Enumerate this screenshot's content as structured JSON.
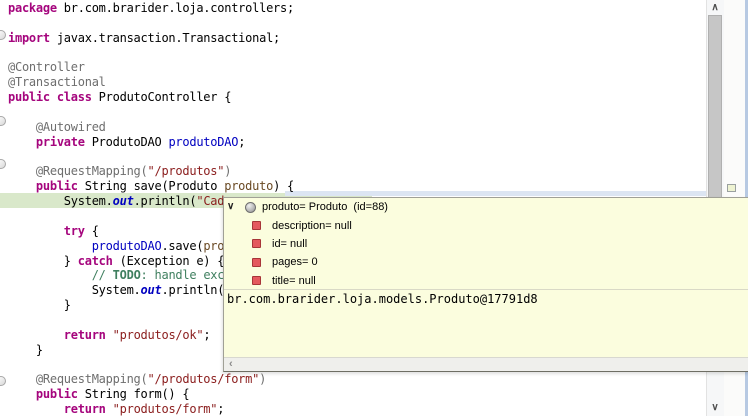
{
  "editor": {
    "lines": [
      {
        "segments": [
          {
            "t": "package",
            "s": "kw"
          },
          {
            "t": " br.com.brarider.loja.controllers;",
            "s": "pl"
          }
        ]
      },
      {
        "segments": []
      },
      {
        "segments": [
          {
            "t": "import",
            "s": "kw"
          },
          {
            "t": " javax.transaction.Transactional;",
            "s": "pl"
          }
        ]
      },
      {
        "segments": []
      },
      {
        "segments": [
          {
            "t": "@Controller",
            "s": "ann"
          }
        ]
      },
      {
        "segments": [
          {
            "t": "@Transactional",
            "s": "ann"
          }
        ]
      },
      {
        "segments": [
          {
            "t": "public class",
            "s": "kw"
          },
          {
            "t": " ProdutoController {",
            "s": "pl"
          }
        ]
      },
      {
        "segments": []
      },
      {
        "segments": [
          {
            "t": "    ",
            "s": "pl"
          },
          {
            "t": "@Autowired",
            "s": "ann"
          }
        ]
      },
      {
        "segments": [
          {
            "t": "    ",
            "s": "pl"
          },
          {
            "t": "private",
            "s": "kw"
          },
          {
            "t": " ProdutoDAO ",
            "s": "pl"
          },
          {
            "t": "produtoDAO",
            "s": "fld"
          },
          {
            "t": ";",
            "s": "pl"
          }
        ]
      },
      {
        "segments": []
      },
      {
        "segments": [
          {
            "t": "    ",
            "s": "pl"
          },
          {
            "t": "@RequestMapping(",
            "s": "ann"
          },
          {
            "t": "\"/produtos\"",
            "s": "str"
          },
          {
            "t": ")",
            "s": "ann"
          }
        ]
      },
      {
        "segments": [
          {
            "t": "    ",
            "s": "pl"
          },
          {
            "t": "public",
            "s": "kw"
          },
          {
            "t": " String save(Produto ",
            "s": "pl"
          },
          {
            "t": "produto",
            "s": "prm"
          },
          {
            "t": ") {",
            "s": "pl"
          }
        ]
      },
      {
        "segments": [
          {
            "t": "        System.",
            "s": "pl"
          },
          {
            "t": "out",
            "s": "sf"
          },
          {
            "t": ".println(",
            "s": "pl"
          },
          {
            "t": "\"Cad",
            "s": "str"
          }
        ]
      },
      {
        "segments": []
      },
      {
        "segments": [
          {
            "t": "        ",
            "s": "pl"
          },
          {
            "t": "try",
            "s": "kw"
          },
          {
            "t": " {",
            "s": "pl"
          }
        ]
      },
      {
        "segments": [
          {
            "t": "            ",
            "s": "pl"
          },
          {
            "t": "produtoDAO",
            "s": "fld"
          },
          {
            "t": ".save(",
            "s": "pl"
          },
          {
            "t": "pro",
            "s": "prm"
          }
        ]
      },
      {
        "segments": [
          {
            "t": "        } ",
            "s": "pl"
          },
          {
            "t": "catch",
            "s": "kw"
          },
          {
            "t": " (Exception e) {",
            "s": "pl"
          }
        ]
      },
      {
        "segments": [
          {
            "t": "            ",
            "s": "pl"
          },
          {
            "t": "// ",
            "s": "com"
          },
          {
            "t": "TODO",
            "s": "todo"
          },
          {
            "t": ": handle exc",
            "s": "com"
          }
        ]
      },
      {
        "segments": [
          {
            "t": "            System.",
            "s": "pl"
          },
          {
            "t": "out",
            "s": "sf"
          },
          {
            "t": ".println(",
            "s": "pl"
          }
        ]
      },
      {
        "segments": [
          {
            "t": "        }",
            "s": "pl"
          }
        ]
      },
      {
        "segments": []
      },
      {
        "segments": [
          {
            "t": "        ",
            "s": "pl"
          },
          {
            "t": "return",
            "s": "kw"
          },
          {
            "t": " ",
            "s": "pl"
          },
          {
            "t": "\"produtos/ok\"",
            "s": "str"
          },
          {
            "t": ";",
            "s": "pl"
          }
        ]
      },
      {
        "segments": [
          {
            "t": "    }",
            "s": "pl"
          }
        ]
      },
      {
        "segments": []
      },
      {
        "segments": [
          {
            "t": "    ",
            "s": "pl"
          },
          {
            "t": "@RequestMapping(",
            "s": "ann"
          },
          {
            "t": "\"/produtos/form\"",
            "s": "str"
          },
          {
            "t": ")",
            "s": "ann"
          }
        ]
      },
      {
        "segments": [
          {
            "t": "    ",
            "s": "pl"
          },
          {
            "t": "public",
            "s": "kw"
          },
          {
            "t": " String form() {",
            "s": "pl"
          }
        ]
      },
      {
        "segments": [
          {
            "t": "        ",
            "s": "pl"
          },
          {
            "t": "return",
            "s": "kw"
          },
          {
            "t": " ",
            "s": "pl"
          },
          {
            "t": "\"produtos/form\"",
            "s": "str"
          },
          {
            "t": ";",
            "s": "pl"
          }
        ]
      }
    ]
  },
  "tooltip": {
    "root_label": "produto= Produto  (id=88)",
    "fields": [
      {
        "label": "description= null"
      },
      {
        "label": "id= null"
      },
      {
        "label": "pages= 0"
      },
      {
        "label": "title= null"
      }
    ],
    "detail": "br.com.brarider.loja.models.Produto@17791d8"
  },
  "icons": {
    "tree_chevron_down": "∨",
    "scroll_up": "∧",
    "scroll_down": "∨",
    "hscroll_left": "‹"
  },
  "colors": {
    "keyword": "#a5057d",
    "annotation": "#6e6e6e",
    "string": "#8b1d1d",
    "comment": "#3f7f5f",
    "field": "#0000c0",
    "current_line_highlight": "#d9e8ca",
    "tooltip_background": "#fbfdde",
    "field_marker": "#e4595e"
  }
}
